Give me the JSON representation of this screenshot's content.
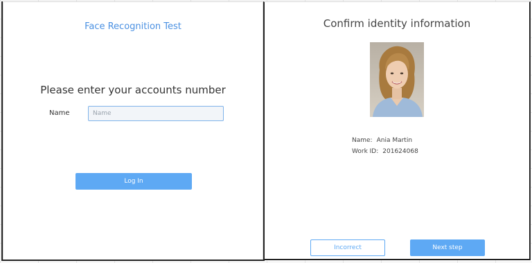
{
  "login_screen": {
    "app_title": "Face Recognition Test",
    "prompt": "Please enter your accounts number",
    "name_label": "Name",
    "name_placeholder": "Name",
    "name_value": "",
    "login_button": "Log In"
  },
  "confirm_screen": {
    "title": "Confirm identity information",
    "photo_icon": "person-photo",
    "name_key": "Name:",
    "name_value": "Ania Martin",
    "workid_key": "Work ID:",
    "workid_value": "201624068",
    "incorrect_button": "Incorrect",
    "next_button": "Next step"
  },
  "colors": {
    "accent": "#5ea9f4",
    "title_blue": "#4a90e2",
    "input_border": "#7fb3ea"
  }
}
